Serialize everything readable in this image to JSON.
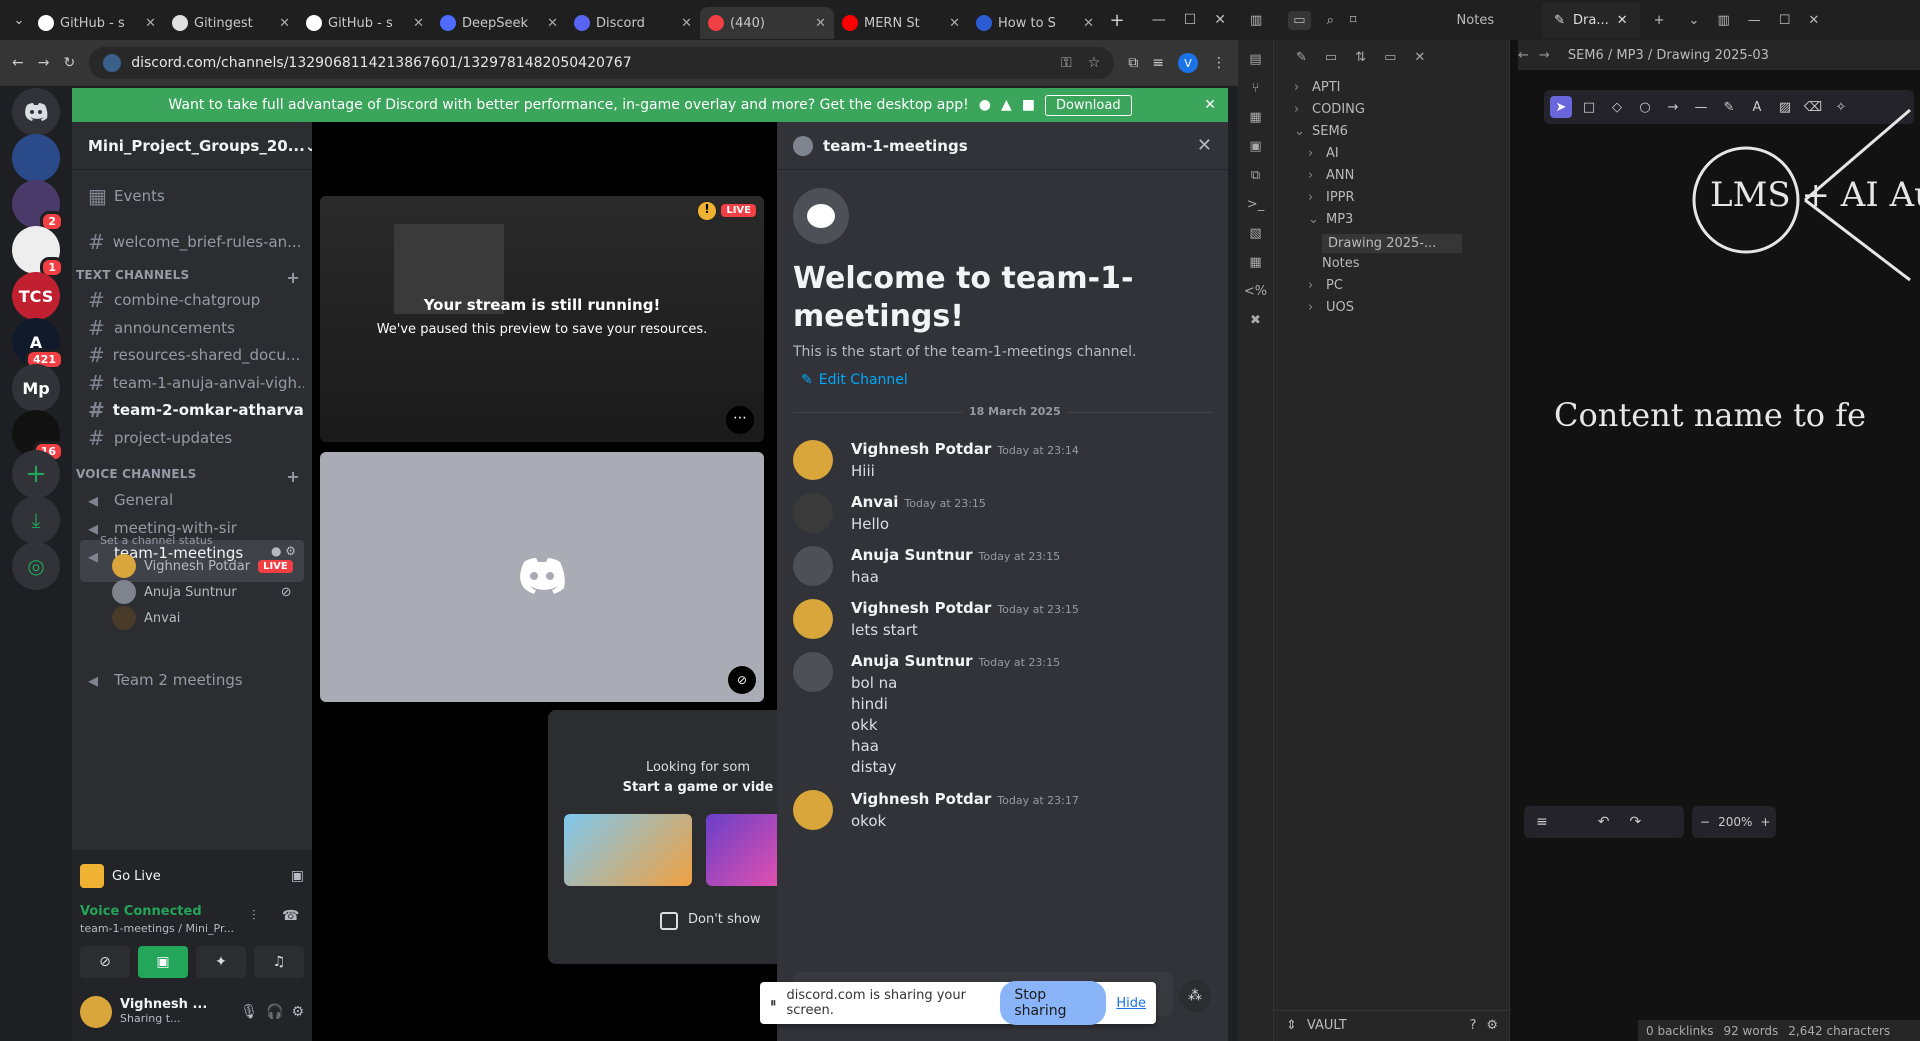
{
  "browser": {
    "tabs": [
      {
        "label": "GitHub - s",
        "color": "#ffffff"
      },
      {
        "label": "Gitingest",
        "color": "#e0e0e0"
      },
      {
        "label": "GitHub - s",
        "color": "#ffffff"
      },
      {
        "label": "DeepSeek",
        "color": "#4d6bfe"
      },
      {
        "label": "Discord",
        "color": "#5865f2"
      },
      {
        "label": "(440)",
        "color": "#f23f43"
      },
      {
        "label": "MERN St",
        "color": "#ff0000"
      },
      {
        "label": "How to S",
        "color": "#2b5cd4"
      }
    ],
    "url": "discord.com/channels/1329068114213867601/1329781482050420767",
    "profile_initial": "V"
  },
  "banner": {
    "text": "Want to take full advantage of Discord with better performance, in-game overlay and more? Get the desktop app!",
    "download_label": "Download"
  },
  "servers": [
    {
      "label": "",
      "badge": ""
    },
    {
      "label": "",
      "badge": "2"
    },
    {
      "label": "",
      "badge": "1"
    },
    {
      "label": "TCS",
      "badge": ""
    },
    {
      "label": "A",
      "badge": "421"
    },
    {
      "label": "Mp",
      "badge": ""
    },
    {
      "label": "",
      "badge": "16"
    }
  ],
  "guild": {
    "name": "Mini_Project_Groups_20...",
    "events_label": "Events",
    "welcome_channel": "welcome_brief-rules-an...",
    "text_category": "TEXT CHANNELS",
    "text_channels": [
      "combine-chatgroup",
      "announcements",
      "resources-shared_docu...",
      "team-1-anuja-anvai-vigh...",
      "team-2-omkar-atharva-...",
      "project-updates"
    ],
    "voice_category": "VOICE CHANNELS",
    "voice_channels": [
      "General",
      "meeting-with-sir",
      "team-1-meetings",
      "Team 2 meetings"
    ],
    "channel_status": "Set a channel status",
    "members": [
      {
        "name": "Vighnesh Potdar",
        "live": "LIVE"
      },
      {
        "name": "Anuja Suntnur",
        "live": ""
      },
      {
        "name": "Anvai",
        "live": ""
      }
    ]
  },
  "panel": {
    "go_live": "Go Live",
    "voice_connected": "Voice Connected",
    "voice_location": "team-1-meetings / Mini_Pr...",
    "user_name": "Vighnesh ...",
    "user_status": "Sharing t..."
  },
  "stage": {
    "stream_title": "Your stream is still running!",
    "stream_sub": "We've paused this preview to save your resources.",
    "live_label": "LIVE",
    "activity_title": "Looking for som",
    "activity_sub": "Start a game or vide",
    "dont_show": "Don't show"
  },
  "chat": {
    "channel": "team-1-meetings",
    "welcome_title": "Welcome to team-1-meetings!",
    "welcome_sub": "This is the start of the team-1-meetings channel.",
    "edit_channel": "Edit Channel",
    "date_divider": "18 March 2025",
    "messages": [
      {
        "author": "Vighnesh Potdar",
        "time": "Today at 23:14",
        "lines": [
          "Hiii"
        ]
      },
      {
        "author": "Anvai",
        "time": "Today at 23:15",
        "lines": [
          "Hello"
        ]
      },
      {
        "author": "Anuja Suntnur",
        "time": "Today at 23:15",
        "lines": [
          "haa"
        ]
      },
      {
        "author": "Vighnesh Potdar",
        "time": "Today at 23:15",
        "lines": [
          "lets start"
        ]
      },
      {
        "author": "Anuja Suntnur",
        "time": "Today at 23:15",
        "lines": [
          "bol na",
          "hindi",
          "okk",
          "haa",
          "distay"
        ]
      },
      {
        "author": "Vighnesh Potdar",
        "time": "Today at 23:17",
        "lines": [
          "okok"
        ]
      }
    ]
  },
  "share_bar": {
    "text": "discord.com is sharing your screen.",
    "stop_label": "Stop sharing",
    "hide_label": "Hide"
  },
  "obsidian": {
    "tabs": [
      "Notes",
      "Dra..."
    ],
    "breadcrumb": "SEM6 / MP3 / Drawing 2025-03",
    "tree": [
      {
        "label": "APTI",
        "level": 0,
        "open": false
      },
      {
        "label": "CODING",
        "level": 0,
        "open": false
      },
      {
        "label": "SEM6",
        "level": 0,
        "open": true
      },
      {
        "label": "AI",
        "level": 1,
        "open": false
      },
      {
        "label": "ANN",
        "level": 1,
        "open": false
      },
      {
        "label": "IPPR",
        "level": 1,
        "open": false
      },
      {
        "label": "MP3",
        "level": 1,
        "open": true
      },
      {
        "label": "Drawing 2025-...",
        "level": 2,
        "open": false
      },
      {
        "label": "Notes",
        "level": 2,
        "open": false
      },
      {
        "label": "PC",
        "level": 1,
        "open": false
      },
      {
        "label": "UOS",
        "level": 1,
        "open": false
      }
    ],
    "vault_label": "VAULT",
    "drawing_text_1": "LMS + AI Au",
    "drawing_text_2": "Content name to fe",
    "zoom": "200%",
    "status": [
      "0 backlinks",
      "92 words",
      "2,642 characters"
    ]
  },
  "colors": {
    "discord_blurple": "#5865f2",
    "banner_green": "#3ba55c",
    "live_red": "#f23f43",
    "voice_green": "#23a55a",
    "link_blue": "#00a8fc"
  }
}
